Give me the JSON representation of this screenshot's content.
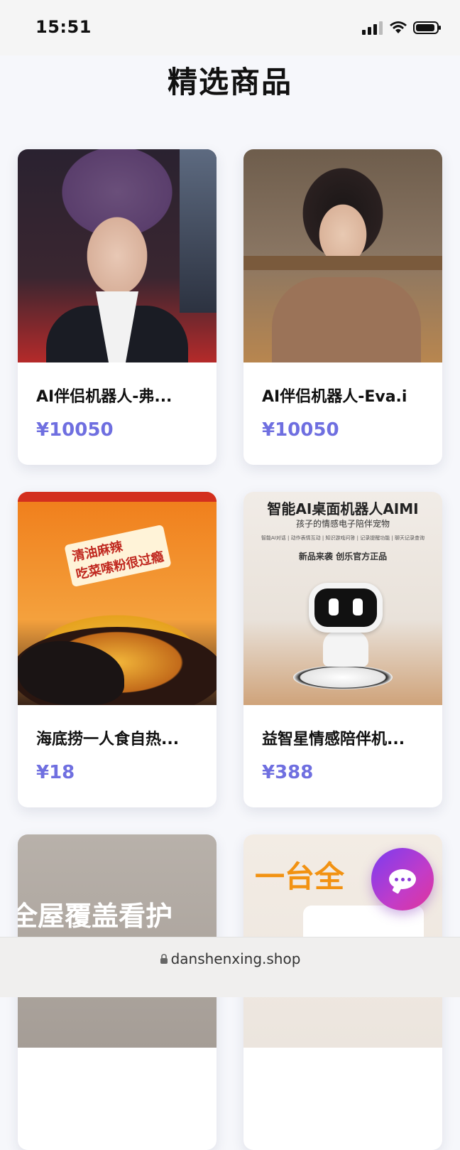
{
  "status_bar": {
    "time": "15:51",
    "icons": [
      "signal-icon",
      "wifi-icon",
      "battery-icon"
    ]
  },
  "page": {
    "title": "精选商品"
  },
  "products": [
    {
      "name": "AI伴侣机器人-弗...",
      "price": "¥10050",
      "image": "product-image-ai-companion-male"
    },
    {
      "name": "AI伴侣机器人-Eva.i",
      "price": "¥10050",
      "image": "product-image-ai-companion-female"
    },
    {
      "name": "海底捞一人食自热...",
      "price": "¥18",
      "image": "product-image-hotpot",
      "image_text": [
        "清油麻辣",
        "吃菜嗦粉很过瘾"
      ]
    },
    {
      "name": "益智星情感陪伴机...",
      "price": "¥388",
      "image": "product-image-desktop-robot",
      "image_text": [
        "智能AI桌面机器人AIMI",
        "孩子的情感电子陪伴宠物",
        "智能AI对话 | 动作表情互动 | 知识游戏问答 | 记录提醒功能 | 聊天记录查询",
        "新品来袭   创乐官方正品"
      ]
    },
    {
      "name": "",
      "price": "",
      "image": "product-image-home-camera",
      "image_text": [
        "全屋覆盖看护"
      ]
    },
    {
      "name": "",
      "price": "",
      "image": "product-image-appliance",
      "image_text": [
        "一台全"
      ]
    }
  ],
  "chat_button": {
    "icon": "chat-bubble-icon"
  },
  "browser": {
    "url": "danshenxing.shop",
    "lock_icon": "lock-icon"
  },
  "colors": {
    "price": "#6f6fe0",
    "chat_gradient_start": "#7a3cf0",
    "chat_gradient_end": "#e0349a",
    "background": "#f6f7fb"
  }
}
